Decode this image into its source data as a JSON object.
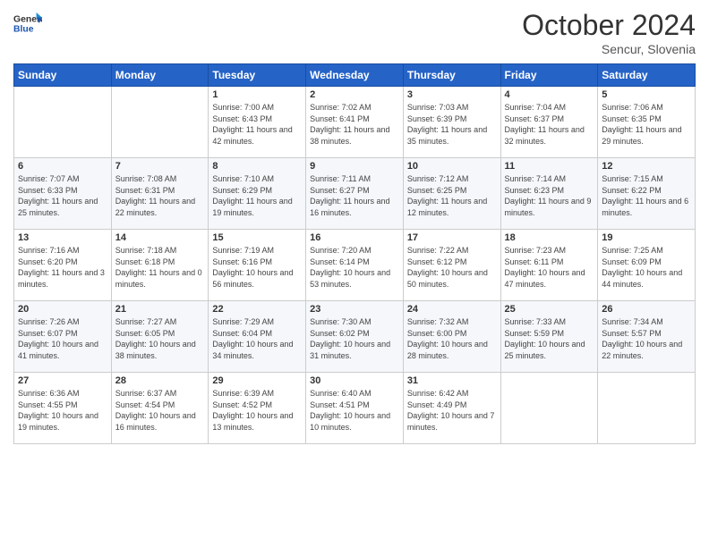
{
  "header": {
    "logo_general": "General",
    "logo_blue": "Blue",
    "month_title": "October 2024",
    "subtitle": "Sencur, Slovenia"
  },
  "days_of_week": [
    "Sunday",
    "Monday",
    "Tuesday",
    "Wednesday",
    "Thursday",
    "Friday",
    "Saturday"
  ],
  "weeks": [
    [
      {
        "day": "",
        "sunrise": "",
        "sunset": "",
        "daylight": ""
      },
      {
        "day": "",
        "sunrise": "",
        "sunset": "",
        "daylight": ""
      },
      {
        "day": "1",
        "sunrise": "Sunrise: 7:00 AM",
        "sunset": "Sunset: 6:43 PM",
        "daylight": "Daylight: 11 hours and 42 minutes."
      },
      {
        "day": "2",
        "sunrise": "Sunrise: 7:02 AM",
        "sunset": "Sunset: 6:41 PM",
        "daylight": "Daylight: 11 hours and 38 minutes."
      },
      {
        "day": "3",
        "sunrise": "Sunrise: 7:03 AM",
        "sunset": "Sunset: 6:39 PM",
        "daylight": "Daylight: 11 hours and 35 minutes."
      },
      {
        "day": "4",
        "sunrise": "Sunrise: 7:04 AM",
        "sunset": "Sunset: 6:37 PM",
        "daylight": "Daylight: 11 hours and 32 minutes."
      },
      {
        "day": "5",
        "sunrise": "Sunrise: 7:06 AM",
        "sunset": "Sunset: 6:35 PM",
        "daylight": "Daylight: 11 hours and 29 minutes."
      }
    ],
    [
      {
        "day": "6",
        "sunrise": "Sunrise: 7:07 AM",
        "sunset": "Sunset: 6:33 PM",
        "daylight": "Daylight: 11 hours and 25 minutes."
      },
      {
        "day": "7",
        "sunrise": "Sunrise: 7:08 AM",
        "sunset": "Sunset: 6:31 PM",
        "daylight": "Daylight: 11 hours and 22 minutes."
      },
      {
        "day": "8",
        "sunrise": "Sunrise: 7:10 AM",
        "sunset": "Sunset: 6:29 PM",
        "daylight": "Daylight: 11 hours and 19 minutes."
      },
      {
        "day": "9",
        "sunrise": "Sunrise: 7:11 AM",
        "sunset": "Sunset: 6:27 PM",
        "daylight": "Daylight: 11 hours and 16 minutes."
      },
      {
        "day": "10",
        "sunrise": "Sunrise: 7:12 AM",
        "sunset": "Sunset: 6:25 PM",
        "daylight": "Daylight: 11 hours and 12 minutes."
      },
      {
        "day": "11",
        "sunrise": "Sunrise: 7:14 AM",
        "sunset": "Sunset: 6:23 PM",
        "daylight": "Daylight: 11 hours and 9 minutes."
      },
      {
        "day": "12",
        "sunrise": "Sunrise: 7:15 AM",
        "sunset": "Sunset: 6:22 PM",
        "daylight": "Daylight: 11 hours and 6 minutes."
      }
    ],
    [
      {
        "day": "13",
        "sunrise": "Sunrise: 7:16 AM",
        "sunset": "Sunset: 6:20 PM",
        "daylight": "Daylight: 11 hours and 3 minutes."
      },
      {
        "day": "14",
        "sunrise": "Sunrise: 7:18 AM",
        "sunset": "Sunset: 6:18 PM",
        "daylight": "Daylight: 11 hours and 0 minutes."
      },
      {
        "day": "15",
        "sunrise": "Sunrise: 7:19 AM",
        "sunset": "Sunset: 6:16 PM",
        "daylight": "Daylight: 10 hours and 56 minutes."
      },
      {
        "day": "16",
        "sunrise": "Sunrise: 7:20 AM",
        "sunset": "Sunset: 6:14 PM",
        "daylight": "Daylight: 10 hours and 53 minutes."
      },
      {
        "day": "17",
        "sunrise": "Sunrise: 7:22 AM",
        "sunset": "Sunset: 6:12 PM",
        "daylight": "Daylight: 10 hours and 50 minutes."
      },
      {
        "day": "18",
        "sunrise": "Sunrise: 7:23 AM",
        "sunset": "Sunset: 6:11 PM",
        "daylight": "Daylight: 10 hours and 47 minutes."
      },
      {
        "day": "19",
        "sunrise": "Sunrise: 7:25 AM",
        "sunset": "Sunset: 6:09 PM",
        "daylight": "Daylight: 10 hours and 44 minutes."
      }
    ],
    [
      {
        "day": "20",
        "sunrise": "Sunrise: 7:26 AM",
        "sunset": "Sunset: 6:07 PM",
        "daylight": "Daylight: 10 hours and 41 minutes."
      },
      {
        "day": "21",
        "sunrise": "Sunrise: 7:27 AM",
        "sunset": "Sunset: 6:05 PM",
        "daylight": "Daylight: 10 hours and 38 minutes."
      },
      {
        "day": "22",
        "sunrise": "Sunrise: 7:29 AM",
        "sunset": "Sunset: 6:04 PM",
        "daylight": "Daylight: 10 hours and 34 minutes."
      },
      {
        "day": "23",
        "sunrise": "Sunrise: 7:30 AM",
        "sunset": "Sunset: 6:02 PM",
        "daylight": "Daylight: 10 hours and 31 minutes."
      },
      {
        "day": "24",
        "sunrise": "Sunrise: 7:32 AM",
        "sunset": "Sunset: 6:00 PM",
        "daylight": "Daylight: 10 hours and 28 minutes."
      },
      {
        "day": "25",
        "sunrise": "Sunrise: 7:33 AM",
        "sunset": "Sunset: 5:59 PM",
        "daylight": "Daylight: 10 hours and 25 minutes."
      },
      {
        "day": "26",
        "sunrise": "Sunrise: 7:34 AM",
        "sunset": "Sunset: 5:57 PM",
        "daylight": "Daylight: 10 hours and 22 minutes."
      }
    ],
    [
      {
        "day": "27",
        "sunrise": "Sunrise: 6:36 AM",
        "sunset": "Sunset: 4:55 PM",
        "daylight": "Daylight: 10 hours and 19 minutes."
      },
      {
        "day": "28",
        "sunrise": "Sunrise: 6:37 AM",
        "sunset": "Sunset: 4:54 PM",
        "daylight": "Daylight: 10 hours and 16 minutes."
      },
      {
        "day": "29",
        "sunrise": "Sunrise: 6:39 AM",
        "sunset": "Sunset: 4:52 PM",
        "daylight": "Daylight: 10 hours and 13 minutes."
      },
      {
        "day": "30",
        "sunrise": "Sunrise: 6:40 AM",
        "sunset": "Sunset: 4:51 PM",
        "daylight": "Daylight: 10 hours and 10 minutes."
      },
      {
        "day": "31",
        "sunrise": "Sunrise: 6:42 AM",
        "sunset": "Sunset: 4:49 PM",
        "daylight": "Daylight: 10 hours and 7 minutes."
      },
      {
        "day": "",
        "sunrise": "",
        "sunset": "",
        "daylight": ""
      },
      {
        "day": "",
        "sunrise": "",
        "sunset": "",
        "daylight": ""
      }
    ]
  ]
}
